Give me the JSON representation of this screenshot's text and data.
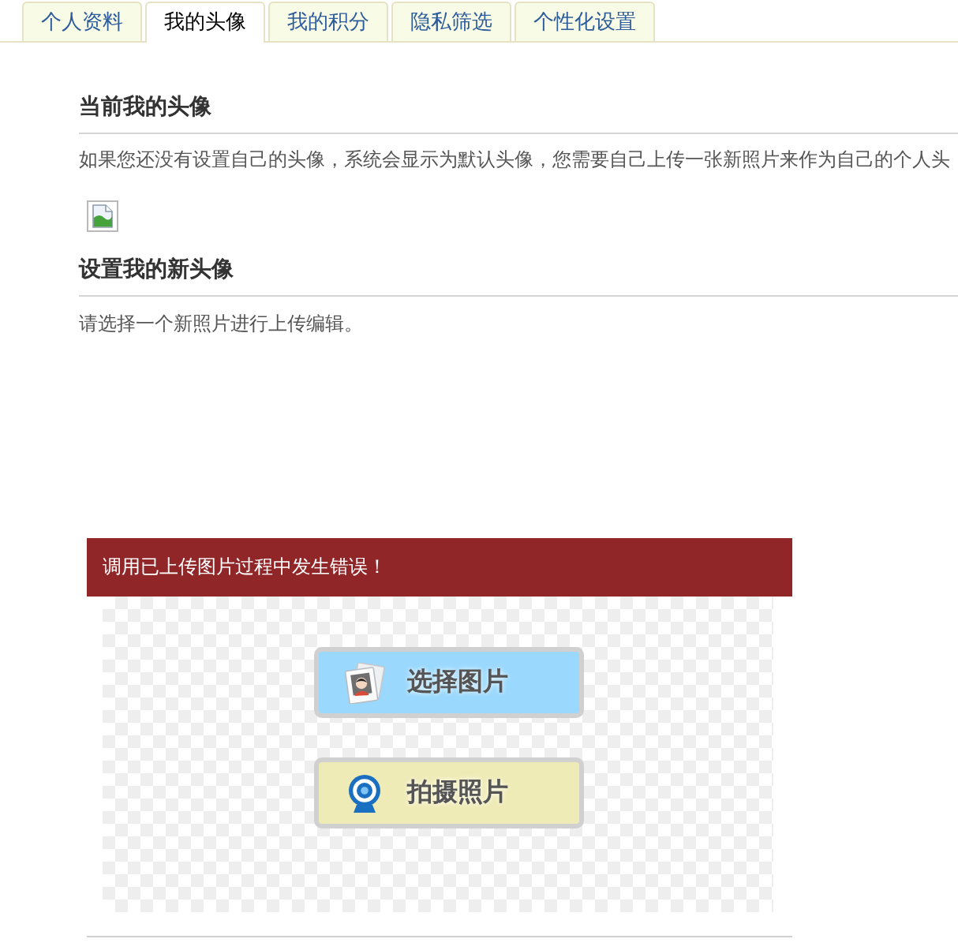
{
  "tabs": [
    {
      "label": "个人资料",
      "selected": false
    },
    {
      "label": "我的头像",
      "selected": true
    },
    {
      "label": "我的积分",
      "selected": false
    },
    {
      "label": "隐私筛选",
      "selected": false
    },
    {
      "label": "个性化设置",
      "selected": false
    }
  ],
  "current_avatar": {
    "title": "当前我的头像",
    "description": "如果您还没有设置自己的头像，系统会显示为默认头像，您需要自己上传一张新照片来作为自己的个人头"
  },
  "new_avatar": {
    "title": "设置我的新头像",
    "description": "请选择一个新照片进行上传编辑。"
  },
  "uploader": {
    "error": "调用已上传图片过程中发生错误！",
    "buttons": [
      {
        "label": "选择图片",
        "kind": "browse"
      },
      {
        "label": "拍摄照片",
        "kind": "camera"
      }
    ]
  }
}
